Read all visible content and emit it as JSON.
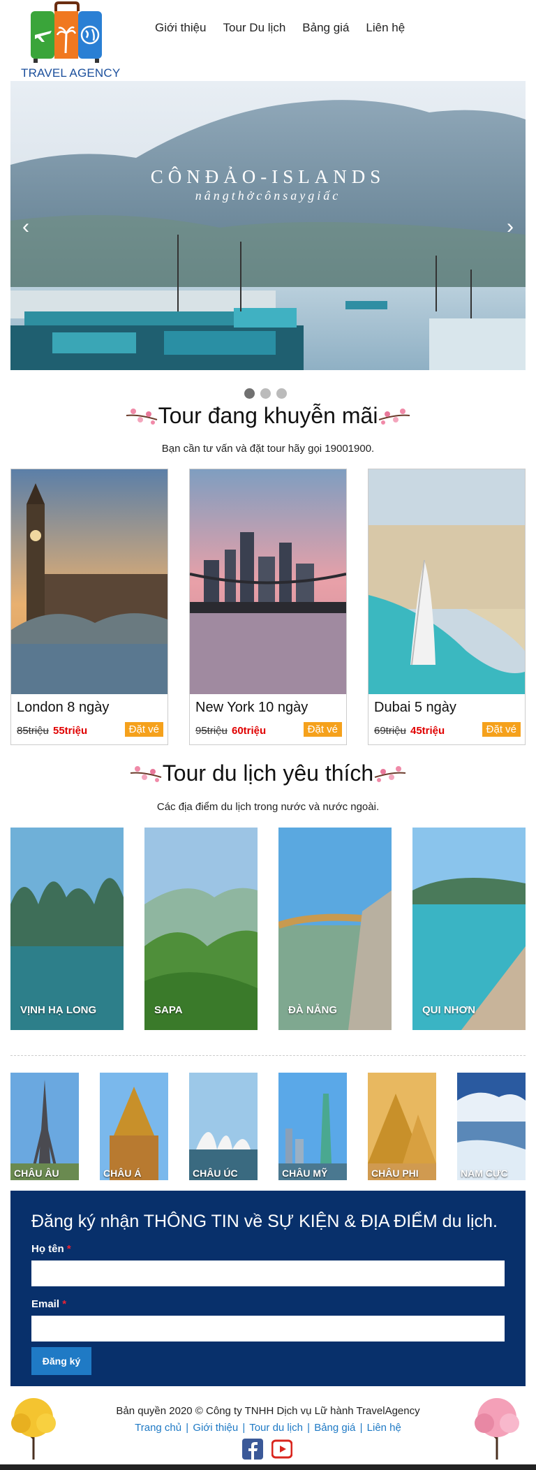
{
  "header": {
    "logo_text": "TRAVEL AGENCY",
    "nav": [
      "Giới thiệu",
      "Tour Du lịch",
      "Bảng giá",
      "Liên hệ"
    ]
  },
  "slider": {
    "caption_title": "CÔNĐẢO-ISLANDS",
    "caption_sub": "nângthởcônsaygiấc",
    "prev": "‹",
    "next": "›",
    "slide_count": 3,
    "active_slide": 1
  },
  "promo": {
    "title": "Tour đang khuyễn mãi",
    "subtitle": "Bạn cần tư vấn và đặt tour hãy gọi 19001900.",
    "cards": [
      {
        "name": "London 8 ngày",
        "old_price": "85triệu",
        "new_price": "55triệu",
        "button": "Đặt vé"
      },
      {
        "name": "New York 10 ngày",
        "old_price": "95triệu",
        "new_price": "60triệu",
        "button": "Đặt vé"
      },
      {
        "name": "Dubai 5 ngày",
        "old_price": "69triệu",
        "new_price": "45triệu",
        "button": "Đặt vé"
      }
    ]
  },
  "favorites": {
    "title": "Tour du lịch yêu thích",
    "subtitle": "Các địa điểm du lịch trong nước và nước ngoài.",
    "items": [
      "VỊNH HẠ LONG",
      "SAPA",
      "ĐÀ NẴNG",
      "QUI NHƠN"
    ]
  },
  "continents": [
    "CHÂU ÂU",
    "CHÂU Á",
    "CHÂU ÚC",
    "CHÂU MỸ",
    "CHÂU PHI",
    "NAM CỰC"
  ],
  "subscribe": {
    "title": "Đăng ký nhận THÔNG TIN về SỰ KIỆN & ĐỊA ĐIỂM du lịch.",
    "name_label": "Họ tên",
    "email_label": "Email",
    "required_mark": "*",
    "name_value": "",
    "email_value": "",
    "submit": "Đăng ký"
  },
  "footer": {
    "copyright": "Bản quyền 2020 © Công ty TNHH Dịch vụ Lữ hành TravelAgency",
    "links": [
      "Trang chủ",
      "Giới thiệu",
      "Tour du lịch",
      "Bảng giá",
      "Liên hệ"
    ],
    "separator": "|",
    "social": [
      "facebook-icon",
      "youtube-icon"
    ]
  },
  "colors": {
    "brand_blue": "#1b4f9c",
    "subscribe_bg": "#08306b",
    "button_orange": "#f5a11c",
    "sale_red": "#e00000",
    "link_blue": "#1f7ac5"
  }
}
